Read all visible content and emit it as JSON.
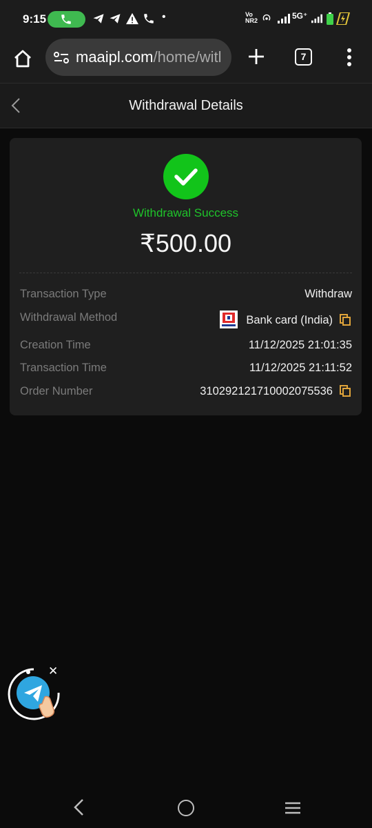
{
  "status_bar": {
    "time": "9:15",
    "network": "5G⁺",
    "carrier": "Vo NR2"
  },
  "browser": {
    "url_host": "maaipl.com",
    "url_path": "/home/witl",
    "tab_count": "7"
  },
  "header": {
    "title": "Withdrawal Details"
  },
  "details": {
    "status_text": "Withdrawal Success",
    "amount": "₹500.00",
    "rows": [
      {
        "label": "Transaction Type",
        "value": "Withdraw"
      },
      {
        "label": "Withdrawal Method",
        "value": "Bank card (India)"
      },
      {
        "label": "Creation Time",
        "value": "11/12/2025 21:01:35"
      },
      {
        "label": "Transaction Time",
        "value": "11/12/2025 21:11:52"
      },
      {
        "label": "Order Number",
        "value": "310292121710002075536"
      }
    ]
  },
  "floating": {
    "close_label": "✕"
  },
  "colors": {
    "success": "#12c41a",
    "copy_icon": "#e0a43a",
    "background": "#0b0b0b",
    "card": "#1f1f1f"
  },
  "icons": {
    "call": "phone-icon",
    "home": "home-icon",
    "site_settings": "tune-icon",
    "new_tab": "plus-icon",
    "menu": "more-vert-icon",
    "back": "chevron-left-icon",
    "success": "check-circle-icon",
    "copy": "copy-icon",
    "telegram": "telegram-icon"
  }
}
